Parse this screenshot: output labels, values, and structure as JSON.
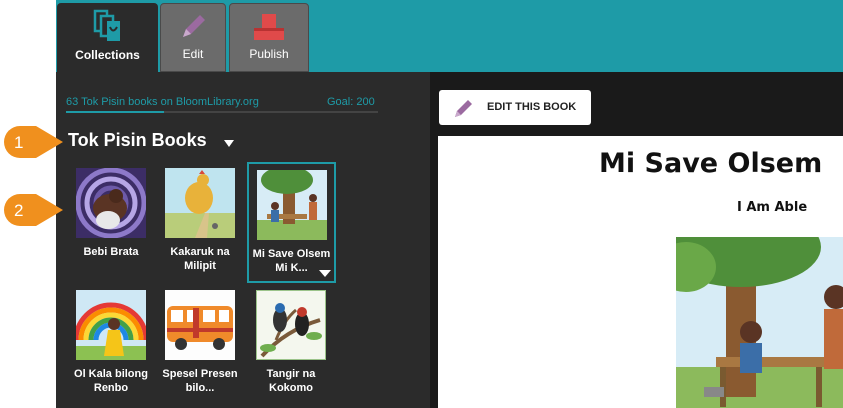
{
  "tabs": [
    {
      "label": "Collections"
    },
    {
      "label": "Edit"
    },
    {
      "label": "Publish"
    }
  ],
  "collections": {
    "progress_text": "63 Tok Pisin books on BloomLibrary.org",
    "goal_text": "Goal: 200",
    "progress_fraction": 0.315,
    "title": "Tok Pisin Books",
    "books": [
      {
        "label": "Bebi Brata"
      },
      {
        "label": "Kakaruk na Milipit"
      },
      {
        "label": "Mi Save Olsem Mi K..."
      },
      {
        "label": "Ol Kala bilong Renbo"
      },
      {
        "label": "Spesel Presen bilo..."
      },
      {
        "label": "Tangir na Kokomo"
      }
    ]
  },
  "toolbar": {
    "edit_button_label": "EDIT THIS BOOK"
  },
  "preview": {
    "title": "Mi Save Olsem",
    "subtitle": "I Am Able"
  },
  "callouts": [
    {
      "number": "1"
    },
    {
      "number": "2"
    }
  ],
  "colors": {
    "accent": "#1e9ba7",
    "panel": "#2b2b2b",
    "callout": "#f0901e"
  }
}
